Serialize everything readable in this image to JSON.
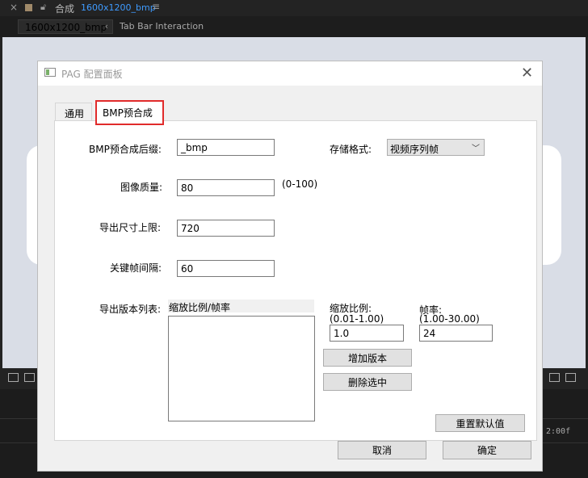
{
  "host": {
    "title": "合成",
    "comp_name": "1600x1200_bmp",
    "tabs": [
      {
        "label": "1600x1200_bmp"
      },
      {
        "label": "Tab Bar Interaction"
      }
    ],
    "time_display": "2:00f"
  },
  "dialog": {
    "title": "PAG 配置面板",
    "tabs": [
      {
        "label": "通用"
      },
      {
        "label": "BMP预合成"
      }
    ],
    "fields": {
      "suffix_label": "BMP预合成后缀:",
      "suffix_value": "_bmp",
      "format_label": "存储格式:",
      "format_value": "视频序列帧",
      "quality_label": "图像质量:",
      "quality_value": "80",
      "quality_range": "(0-100)",
      "max_size_label": "导出尺寸上限:",
      "max_size_value": "720",
      "keyframe_label": "关键帧间隔:",
      "keyframe_value": "60",
      "versions_label": "导出版本列表:",
      "versions_header": "缩放比例/帧率",
      "scale_label": "缩放比例:",
      "scale_range": "(0.01-1.00)",
      "scale_value": "1.0",
      "fps_label": "帧率:",
      "fps_range": "(1.00-30.00)",
      "fps_value": "24"
    },
    "buttons": {
      "add_version": "增加版本",
      "delete_selected": "删除选中",
      "reset_default": "重置默认值",
      "cancel": "取消",
      "ok": "确定"
    }
  },
  "colors": {
    "accent": "#3f9bff",
    "highlight_border": "#e12b2b"
  }
}
